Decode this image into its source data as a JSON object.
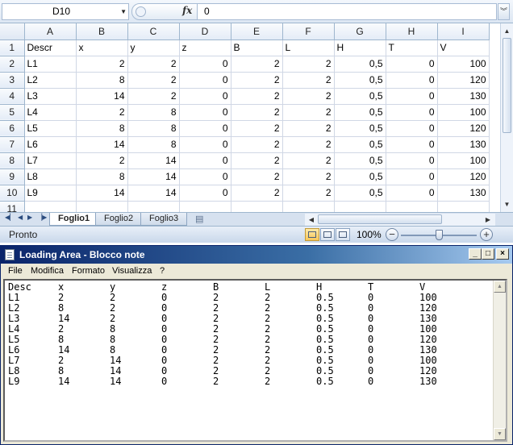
{
  "excel": {
    "name_box": "D10",
    "formula_value": "0",
    "fx_label": "fx",
    "columns": [
      "A",
      "B",
      "C",
      "D",
      "E",
      "F",
      "G",
      "H",
      "I"
    ],
    "rows": [
      {
        "num": "1",
        "cells": [
          "Descr",
          "x",
          "y",
          "z",
          "B",
          "L",
          "H",
          "T",
          "V"
        ]
      },
      {
        "num": "2",
        "cells": [
          "L1",
          "2",
          "2",
          "0",
          "2",
          "2",
          "0,5",
          "0",
          "100"
        ]
      },
      {
        "num": "3",
        "cells": [
          "L2",
          "8",
          "2",
          "0",
          "2",
          "2",
          "0,5",
          "0",
          "120"
        ]
      },
      {
        "num": "4",
        "cells": [
          "L3",
          "14",
          "2",
          "0",
          "2",
          "2",
          "0,5",
          "0",
          "130"
        ]
      },
      {
        "num": "5",
        "cells": [
          "L4",
          "2",
          "8",
          "0",
          "2",
          "2",
          "0,5",
          "0",
          "100"
        ]
      },
      {
        "num": "6",
        "cells": [
          "L5",
          "8",
          "8",
          "0",
          "2",
          "2",
          "0,5",
          "0",
          "120"
        ]
      },
      {
        "num": "7",
        "cells": [
          "L6",
          "14",
          "8",
          "0",
          "2",
          "2",
          "0,5",
          "0",
          "130"
        ]
      },
      {
        "num": "8",
        "cells": [
          "L7",
          "2",
          "14",
          "0",
          "2",
          "2",
          "0,5",
          "0",
          "100"
        ]
      },
      {
        "num": "9",
        "cells": [
          "L8",
          "8",
          "14",
          "0",
          "2",
          "2",
          "0,5",
          "0",
          "120"
        ]
      },
      {
        "num": "10",
        "cells": [
          "L9",
          "14",
          "14",
          "0",
          "2",
          "2",
          "0,5",
          "0",
          "130"
        ]
      },
      {
        "num": "11",
        "cells": [
          "",
          "",
          "",
          "",
          "",
          "",
          "",
          "",
          ""
        ]
      }
    ],
    "sheet_tabs": [
      "Foglio1",
      "Foglio2",
      "Foglio3"
    ],
    "active_tab": 0,
    "status": "Pronto",
    "zoom": "100%",
    "zoom_minus": "−",
    "zoom_plus": "+"
  },
  "notepad": {
    "title": "Loading Area - Blocco note",
    "menu": [
      "File",
      "Modifica",
      "Formato",
      "Visualizza",
      "?"
    ],
    "window_buttons": {
      "minimize": "_",
      "maximize": "□",
      "close": "×"
    },
    "lines": [
      [
        "Desc",
        "x",
        "y",
        "z",
        "B",
        "L",
        "H",
        "T",
        "V"
      ],
      [
        "L1",
        "2",
        "2",
        "0",
        "2",
        "2",
        "0.5",
        "0",
        "100"
      ],
      [
        "L2",
        "8",
        "2",
        "0",
        "2",
        "2",
        "0.5",
        "0",
        "120"
      ],
      [
        "L3",
        "14",
        "2",
        "0",
        "2",
        "2",
        "0.5",
        "0",
        "130"
      ],
      [
        "L4",
        "2",
        "8",
        "0",
        "2",
        "2",
        "0.5",
        "0",
        "100"
      ],
      [
        "L5",
        "8",
        "8",
        "0",
        "2",
        "2",
        "0.5",
        "0",
        "120"
      ],
      [
        "L6",
        "14",
        "8",
        "0",
        "2",
        "2",
        "0.5",
        "0",
        "130"
      ],
      [
        "L7",
        "2",
        "14",
        "0",
        "2",
        "2",
        "0.5",
        "0",
        "100"
      ],
      [
        "L8",
        "8",
        "14",
        "0",
        "2",
        "2",
        "0.5",
        "0",
        "120"
      ],
      [
        "L9",
        "14",
        "14",
        "0",
        "2",
        "2",
        "0.5",
        "0",
        "130"
      ]
    ]
  }
}
